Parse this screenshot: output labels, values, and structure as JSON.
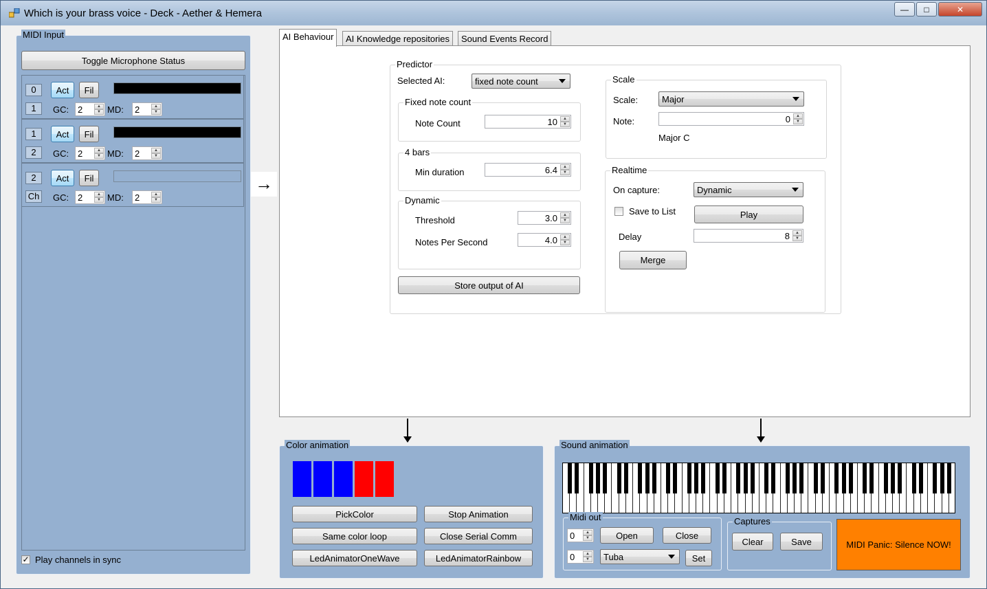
{
  "window": {
    "title": "Which is your brass voice - Deck - Aether & Hemera",
    "min": "—",
    "max": "□",
    "close": "✕"
  },
  "midi_input": {
    "title": "MIDI Input",
    "toggle_mic": "Toggle Microphone Status",
    "channels": [
      {
        "num": "0",
        "sub": "1",
        "act": "Act",
        "fil": "Fil",
        "gc_label": "GC:",
        "gc": "2",
        "md_label": "MD:",
        "md": "2",
        "bar_color": "#000000"
      },
      {
        "num": "1",
        "sub": "2",
        "act": "Act",
        "fil": "Fil",
        "gc_label": "GC:",
        "gc": "2",
        "md_label": "MD:",
        "md": "2",
        "bar_color": "#000000"
      },
      {
        "num": "2",
        "sub": "Ch",
        "act": "Act",
        "fil": "Fil",
        "gc_label": "GC:",
        "gc": "2",
        "md_label": "MD:",
        "md": "2",
        "bar_color": "#95b0d0"
      }
    ],
    "play_sync": "Play channels in sync",
    "play_sync_checked": "✓"
  },
  "tabs": [
    "AI Behaviour",
    "AI Knowledge repositories",
    "Sound Events Record"
  ],
  "predictor": {
    "title": "Predictor",
    "selected_ai_label": "Selected AI:",
    "selected_ai": "fixed note count",
    "fixed": {
      "title": "Fixed note count",
      "note_count_label": "Note Count",
      "note_count": "10"
    },
    "bars": {
      "title": "4 bars",
      "min_duration_label": "Min duration",
      "min_duration": "6.4"
    },
    "dynamic": {
      "title": "Dynamic",
      "threshold_label": "Threshold",
      "threshold": "3.0",
      "nps_label": "Notes Per Second",
      "nps": "4.0"
    },
    "store": "Store output of AI"
  },
  "scale": {
    "title": "Scale",
    "scale_label": "Scale:",
    "scale": "Major",
    "note_label": "Note:",
    "note": "0",
    "result": "Major C"
  },
  "realtime": {
    "title": "Realtime",
    "on_capture_label": "On capture:",
    "on_capture": "Dynamic",
    "save_to_list": "Save to List",
    "play": "Play",
    "delay_label": "Delay",
    "delay": "8",
    "merge": "Merge"
  },
  "flow_arrow": "→",
  "color_animation": {
    "title": "Color animation",
    "swatches": [
      "#0000ff",
      "#0000ff",
      "#0000ff",
      "#ff0000",
      "#ff0000"
    ],
    "buttons": [
      "PickColor",
      "Stop Animation",
      "Same color loop",
      "Close Serial Comm",
      "LedAnimatorOneWave",
      "LedAnimatorRainbow"
    ]
  },
  "sound_animation": {
    "title": "Sound animation",
    "midi_out": {
      "title": "Midi out",
      "port": "0",
      "instrument_num": "0",
      "open": "Open",
      "close": "Close",
      "instrument": "Tuba",
      "set": "Set"
    },
    "captures": {
      "title": "Captures",
      "clear": "Clear",
      "save": "Save"
    },
    "panic": "MIDI Panic: Silence NOW!",
    "panic_color": "#ff8000"
  }
}
